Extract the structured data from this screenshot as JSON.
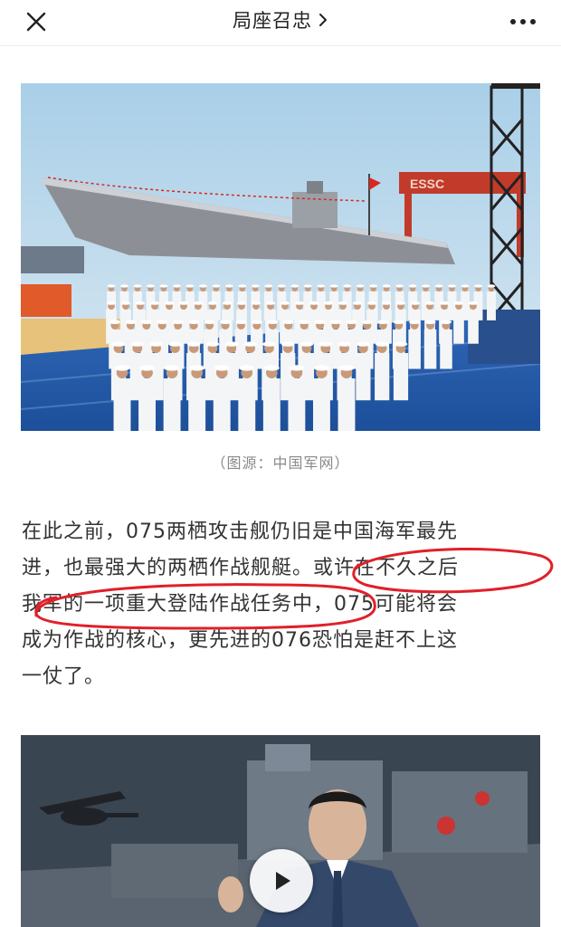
{
  "header": {
    "title": "局座召忠",
    "close_icon": "close-icon",
    "chevron_icon": "chevron-right-icon",
    "more_icon": "more-icon"
  },
  "figure1": {
    "caption": "（图源：中国军网）",
    "image": "ship-ceremony-photo",
    "gantry_sign": "ESSC"
  },
  "article": {
    "lines": [
      "在此之前，075两栖攻击舰仍旧是中国海军最先",
      "进，也最强大的两栖作战舰艇。",
      "或许在不久之后",
      "我军的一项重大登陆作战任务中",
      "，075可能将会",
      "成为作战的核心，更先进的076恐怕是赶不上这",
      "一仗了。"
    ]
  },
  "video": {
    "thumbnail": "ship-diagram-presenter-thumbnail",
    "play_icon": "play-icon"
  },
  "colors": {
    "annotation_red": "#e0202a",
    "text": "#333333",
    "caption": "#8a8a8a"
  }
}
